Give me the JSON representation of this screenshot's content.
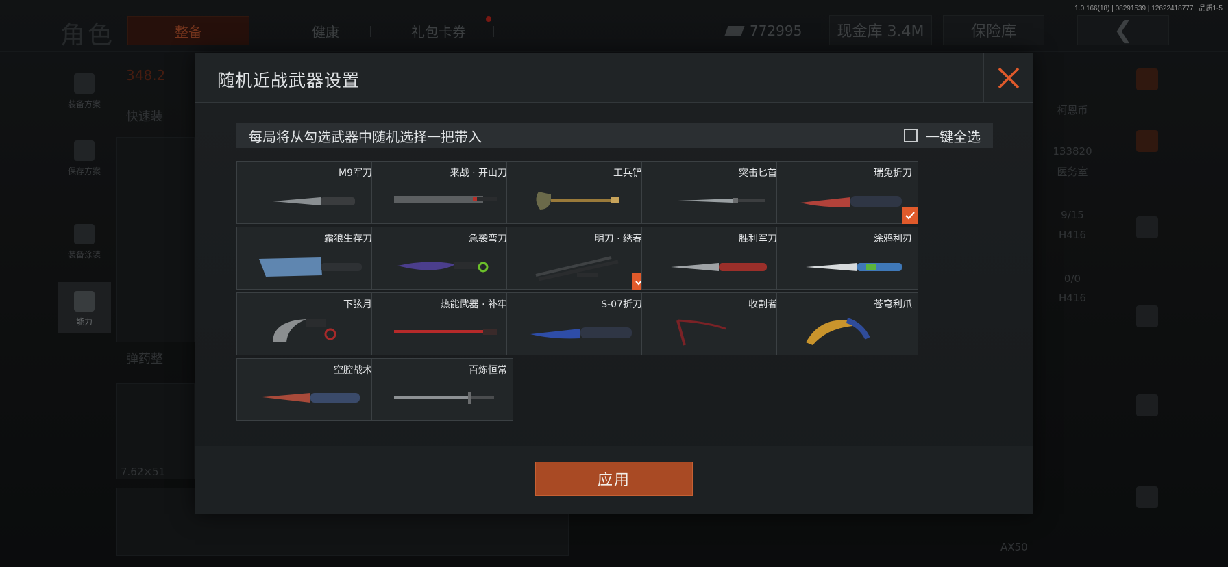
{
  "build_info": "1.0.166(18) | 08291539 | 12622418777 | 品质1-5",
  "background": {
    "title": "角色",
    "tabs": [
      {
        "label": "整备",
        "active": true
      },
      {
        "label": "健康",
        "active": false
      },
      {
        "label": "礼包卡券",
        "active": false
      }
    ],
    "money": "772995",
    "cash_vault": "现金库 3.4M",
    "safe_box": "保险库",
    "back_icon": "chevron-left-icon",
    "left_menu": [
      {
        "label": "装备方案",
        "icon": "vest-icon"
      },
      {
        "label": "保存方案",
        "icon": "download-icon"
      },
      {
        "label": "装备涂装",
        "icon": "helmet-icon"
      },
      {
        "label": "能力",
        "icon": "lightning-hex-icon",
        "active": true
      }
    ],
    "weight": "348.2",
    "quick_equip": "快速装",
    "ammo": "弹药整",
    "caliber": "7.62×51",
    "right_items": [
      {
        "label": "柯恩币",
        "value": "133820"
      },
      {
        "label": "医务室",
        "value": "9/15"
      },
      {
        "label": "H416",
        "value": "0/0"
      },
      {
        "label": "H416",
        "value": ""
      }
    ],
    "bottom_right": "AX50"
  },
  "modal": {
    "title": "随机近战武器设置",
    "close_icon": "close-icon",
    "accent_color": "#e05a2b",
    "info_text": "每局将从勾选武器中随机选择一把带入",
    "select_all": {
      "label": "一键全选",
      "checked": false
    },
    "weapons": [
      {
        "name": "M9军刀",
        "checked": false,
        "color": "#8a8f92"
      },
      {
        "name": "来战 · 开山刀",
        "checked": false,
        "color": "#5c5f61"
      },
      {
        "name": "工兵铲",
        "checked": false,
        "color": "#6b6a4a"
      },
      {
        "name": "突击匕首",
        "checked": false,
        "color": "#9aa0a3"
      },
      {
        "name": "瑞兔折刀",
        "checked": true,
        "color": "#b2423a"
      },
      {
        "name": "霜狼生存刀",
        "checked": false,
        "color": "#5f86b0"
      },
      {
        "name": "急袭弯刀",
        "checked": false,
        "color": "#4b3e8c"
      },
      {
        "name": "明刀 · 绣春",
        "checked": true,
        "color": "#3f4244"
      },
      {
        "name": "胜利军刀",
        "checked": false,
        "color": "#9b2f2a"
      },
      {
        "name": "涂鸦利刃",
        "checked": false,
        "color": "#3f78b8"
      },
      {
        "name": "下弦月",
        "checked": false,
        "color": "#8b8e90"
      },
      {
        "name": "热能武器 · 补牢",
        "checked": false,
        "color": "#b62a2a"
      },
      {
        "name": "S-07折刀",
        "checked": false,
        "color": "#2e4da8"
      },
      {
        "name": "收割者",
        "checked": false,
        "color": "#7a2226"
      },
      {
        "name": "苍穹利爪",
        "checked": false,
        "color": "#c9942c"
      },
      {
        "name": "空腔战术",
        "checked": false,
        "color": "#a84a3a"
      },
      {
        "name": "百炼恒常",
        "checked": false,
        "color": "#8d9194"
      }
    ],
    "apply_label": "应用"
  }
}
